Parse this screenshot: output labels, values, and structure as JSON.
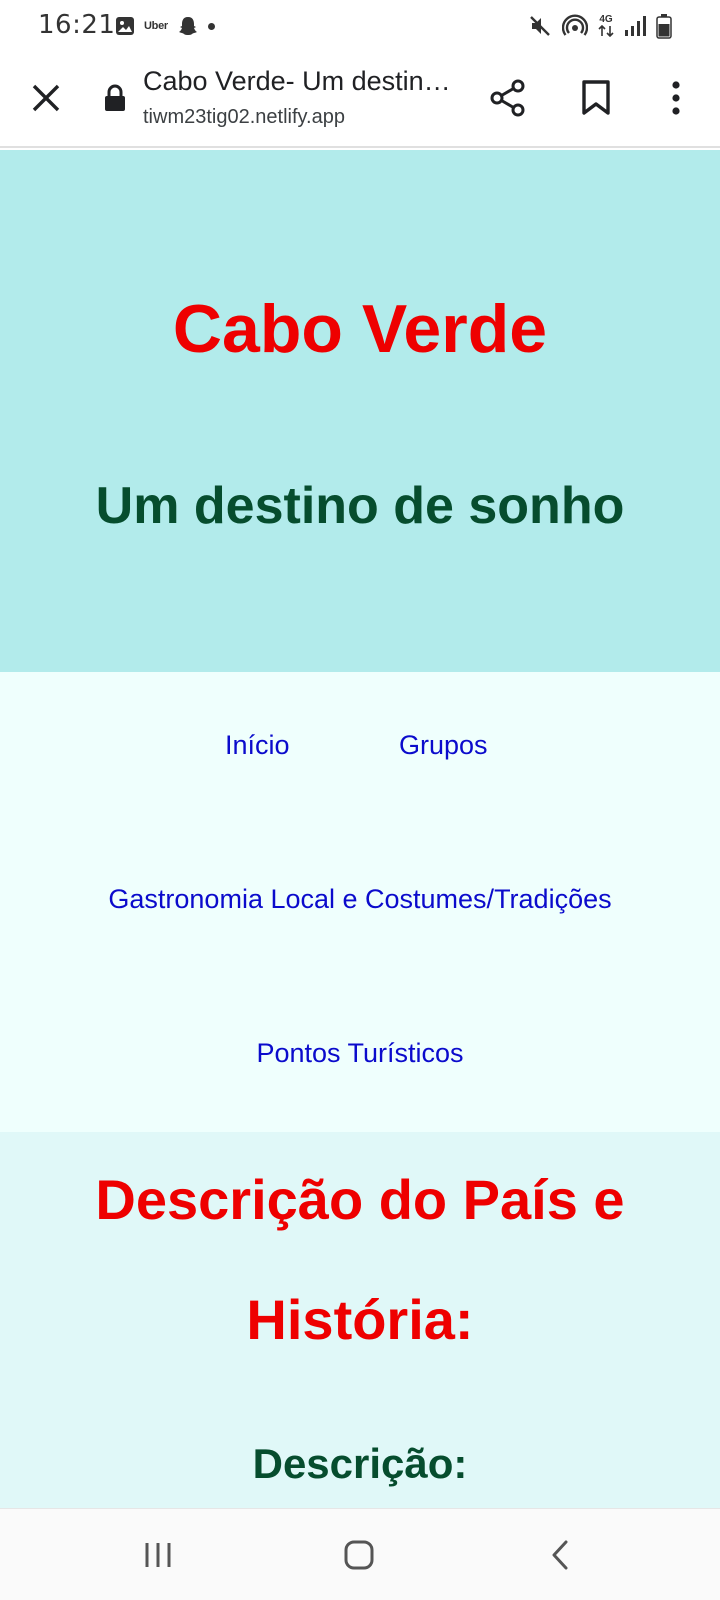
{
  "status_bar": {
    "time": "16:21",
    "uber_label": "Uber",
    "network_label": "4G",
    "left_icons": [
      "gallery-icon",
      "uber-icon",
      "snapchat-icon",
      "dot-icon"
    ],
    "right_icons": [
      "mute-icon",
      "hotspot-icon",
      "4g-icon",
      "signal-icon",
      "battery-icon"
    ]
  },
  "toolbar": {
    "title": "Cabo Verde- Um destino de sonho",
    "url": "tiwm23tig02.netlify.app"
  },
  "hero": {
    "title": "Cabo Verde",
    "subtitle": "Um destino de sonho"
  },
  "nav": {
    "items": [
      {
        "label": "Início"
      },
      {
        "label": "Grupos"
      },
      {
        "label": "Gastronomia Local e Costumes/Tradições"
      },
      {
        "label": "Pontos Turísticos"
      }
    ]
  },
  "section": {
    "title": "Descrição do País e História:",
    "subtitle": "Descrição:"
  },
  "colors": {
    "hero_bg": "#b2ebeb",
    "title_red": "#ee0000",
    "subtitle_green": "#064d2e",
    "link_blue": "#0b0bcc",
    "nav_bg": "#effffd",
    "section_bg": "#e0f8f8"
  }
}
